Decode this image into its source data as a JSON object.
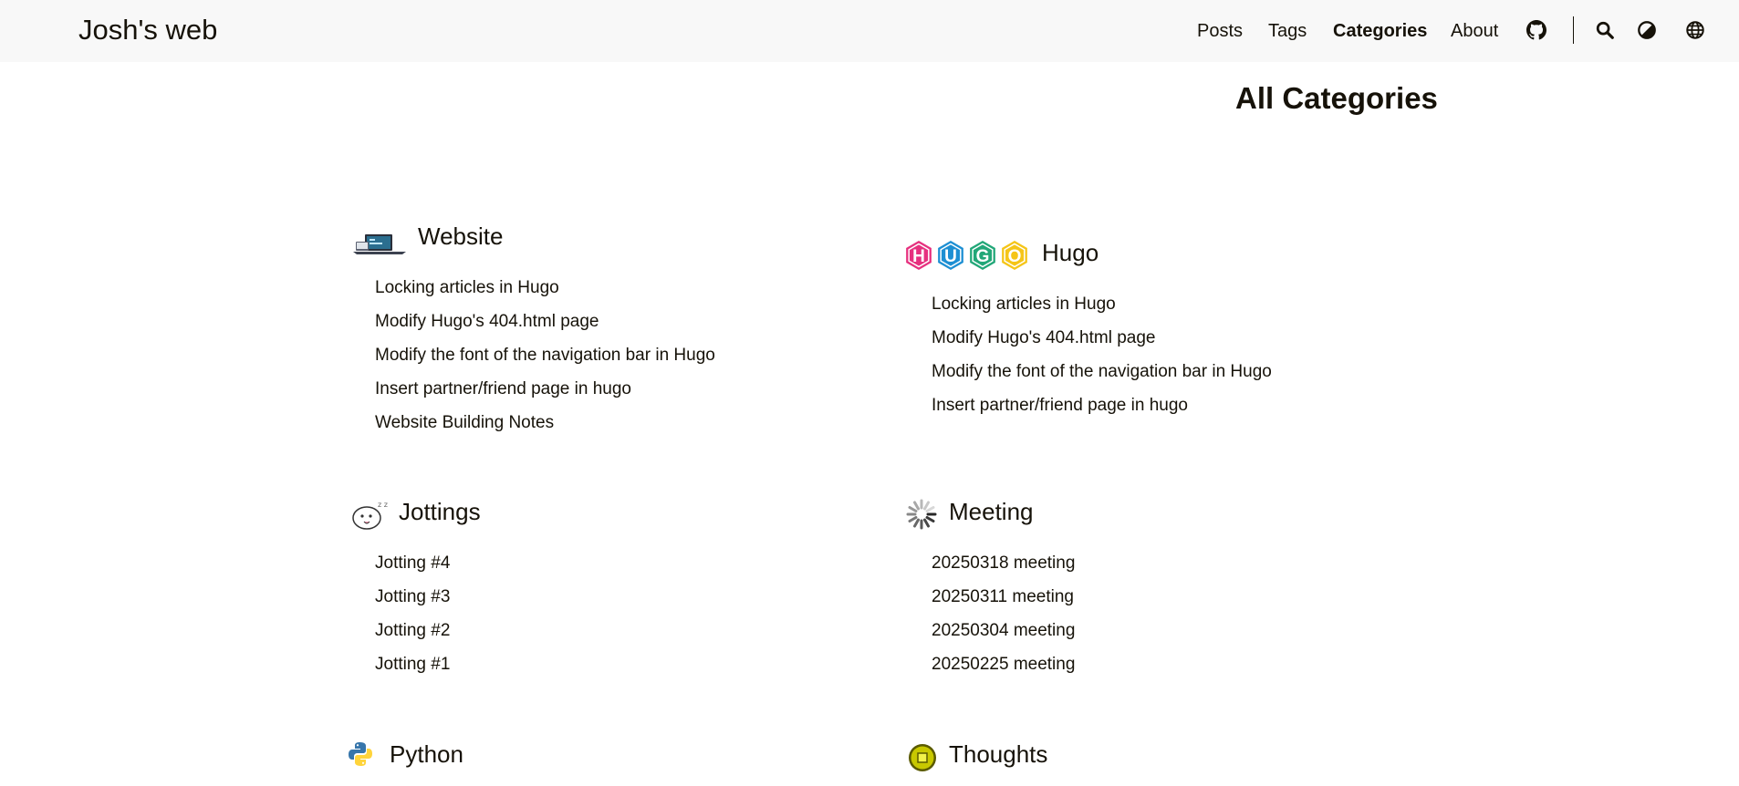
{
  "site": {
    "title": "Josh's web"
  },
  "menu": {
    "posts": "Posts",
    "tags": "Tags",
    "categories": "Categories",
    "about": "About"
  },
  "icons": {
    "github": "github-icon",
    "search": "search-icon",
    "theme": "theme-toggle-icon",
    "language": "globe-icon"
  },
  "page": {
    "title": "All Categories"
  },
  "categories": [
    {
      "name": "Website",
      "icon": "laptop-icon",
      "posts": [
        "Locking articles in Hugo",
        "Modify Hugo's 404.html page",
        "Modify the font of the navigation bar in Hugo",
        "Insert partner/friend page in hugo",
        "Website Building Notes"
      ]
    },
    {
      "name": "Hugo",
      "icon": "hugo-logo-icon",
      "logo_letters": [
        "H",
        "U",
        "G",
        "O"
      ],
      "logo_colors": [
        "#e6317f",
        "#1d8fd3",
        "#22a778",
        "#f5c518"
      ],
      "posts": [
        "Locking articles in Hugo",
        "Modify Hugo's 404.html page",
        "Modify the font of the navigation bar in Hugo",
        "Insert partner/friend page in hugo"
      ]
    },
    {
      "name": "Jottings",
      "icon": "cute-blob-icon",
      "posts": [
        "Jotting #4",
        "Jotting #3",
        "Jotting #2",
        "Jotting #1"
      ]
    },
    {
      "name": "Meeting",
      "icon": "spinner-icon",
      "posts": [
        "20250318 meeting",
        "20250311 meeting",
        "20250304 meeting",
        "20250225 meeting"
      ]
    },
    {
      "name": "Python",
      "icon": "python-icon",
      "posts": []
    },
    {
      "name": "Thoughts",
      "icon": "coin-icon",
      "posts": []
    }
  ]
}
